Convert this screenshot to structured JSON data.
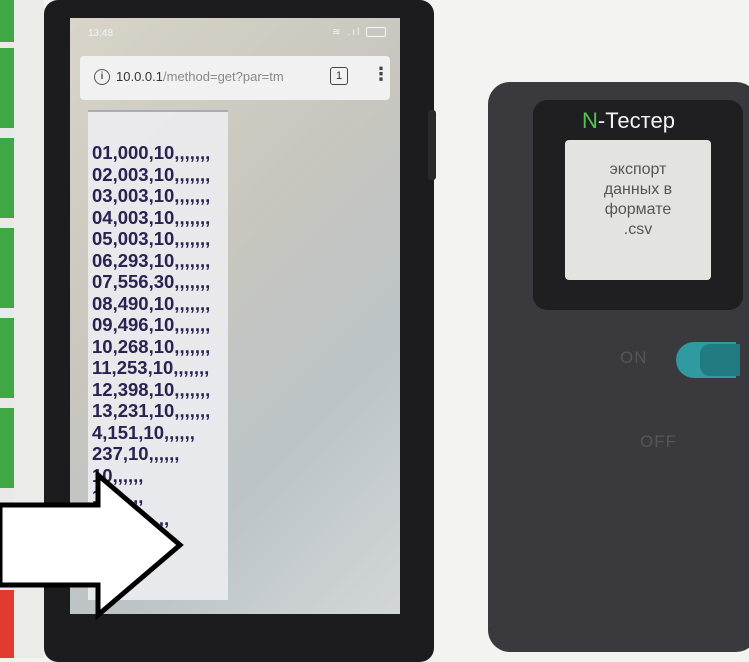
{
  "phone": {
    "status_time": "13:48",
    "url": {
      "host": "10.0.0.1",
      "path": "/method=get?par=tm"
    },
    "tabs_count": "1",
    "menu_glyph": "⋮",
    "csv_lines": [
      "01,000,10,,,,,,,",
      "02,003,10,,,,,,,",
      "03,003,10,,,,,,,",
      "04,003,10,,,,,,,",
      "05,003,10,,,,,,,",
      "06,293,10,,,,,,,",
      "07,556,30,,,,,,,",
      "08,490,10,,,,,,,",
      "09,496,10,,,,,,,",
      "10,268,10,,,,,,,",
      "11,253,10,,,,,,,",
      "12,398,10,,,,,,,",
      "13,231,10,,,,,,,",
      "4,151,10,,,,,,",
      "237,10,,,,,,",
      "10,,,,,,",
      "10,,,,,,",
      "18,10,,,,,,"
    ]
  },
  "device": {
    "brand_prefix": "N",
    "brand_rest": "-Тестер",
    "display_lines": [
      "экспорт",
      "данных в",
      "формате",
      ".csv"
    ],
    "on_label": "ON",
    "off_label": "OFF"
  }
}
